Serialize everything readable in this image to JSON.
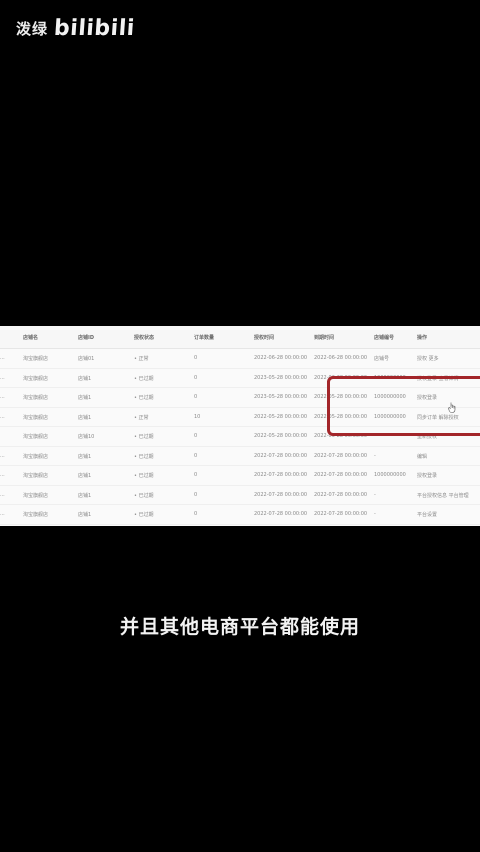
{
  "watermark": {
    "name": "泼绿",
    "logo": "bilibili"
  },
  "table": {
    "headers": [
      "",
      "店铺名",
      "店铺ID",
      "授权状态",
      "订单数量",
      "授权时间",
      "到期时间",
      "店铺编号",
      "操作"
    ],
    "rows": [
      [
        "...",
        "淘宝旗舰店",
        "店铺01",
        "• 正常",
        "0",
        "2022-06-28 00:00:00",
        "2022-06-28 00:00:00",
        "店铺号",
        "授权 更多"
      ],
      [
        "...",
        "淘宝旗舰店",
        "店铺1",
        "• 已过期",
        "0",
        "2023-05-28 00:00:00",
        "2022-06-28 00:00:00",
        "1000000000",
        "授权登录 查看详情"
      ],
      [
        "...",
        "淘宝旗舰店",
        "店铺1",
        "• 已过期",
        "0",
        "2023-05-28 00:00:00",
        "2022-05-28 00:00:00",
        "1000000000",
        "授权登录"
      ],
      [
        "...",
        "淘宝旗舰店",
        "店铺1",
        "• 正常",
        "10",
        "2022-05-28 00:00:00",
        "2022-05-28 00:00:00",
        "1000000000",
        "同步订单 解除授权"
      ],
      [
        "",
        "淘宝旗舰店",
        "店铺10",
        "• 已过期",
        "0",
        "2022-05-28 00:00:00",
        "2022-05-28 00:00:00",
        "-",
        "重新授权"
      ],
      [
        "...",
        "淘宝旗舰店",
        "店铺1",
        "• 已过期",
        "0",
        "2022-07-28 00:00:00",
        "2022-07-28 00:00:00",
        "-",
        "编辑"
      ],
      [
        "...",
        "淘宝旗舰店",
        "店铺1",
        "• 已过期",
        "0",
        "2022-07-28 00:00:00",
        "2022-07-28 00:00:00",
        "1000000000",
        "授权登录"
      ],
      [
        "...",
        "淘宝旗舰店",
        "店铺1",
        "• 已过期",
        "0",
        "2022-07-28 00:00:00",
        "2022-07-28 00:00:00",
        "-",
        "平台授权信息 平台管理"
      ],
      [
        "...",
        "淘宝旗舰店",
        "店铺1",
        "• 已过期",
        "0",
        "2022-07-28 00:00:00",
        "2022-07-28 00:00:00",
        "-",
        "平台设置"
      ],
      [
        "...",
        "淘宝旗舰店",
        "店铺1",
        "• 已过期",
        "0",
        "2022-07-28 00:00:00",
        "2022-07-28 00:00:00",
        "1000000000",
        "授权"
      ]
    ]
  },
  "subtitle": "并且其他电商平台都能使用",
  "colors": {
    "highlight": "#a3262a",
    "table_bg": "#fafafa",
    "page_bg": "#000000"
  }
}
